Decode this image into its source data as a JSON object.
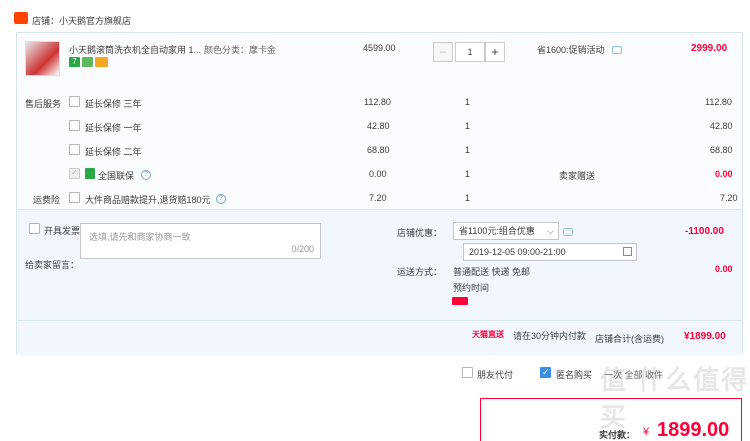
{
  "shop": {
    "label": "店铺：小天鹅官方旗舰店"
  },
  "item": {
    "title": "小天鹅滚筒洗衣机全自动家用 1...",
    "variant": "颜色分类：摩卡金",
    "unit_price": "4599.00",
    "quantity": "1",
    "minus": "−",
    "plus": "+",
    "promo": "省1600:促销活动",
    "subtotal": "2999.00",
    "tag7": "7"
  },
  "services": {
    "label": "售后服务",
    "rows": [
      {
        "name": "延长保修 三年",
        "price": "112.80",
        "qty": "1",
        "total": "112.80"
      },
      {
        "name": "延长保修 一年",
        "price": "42.80",
        "qty": "1",
        "total": "42.80"
      },
      {
        "name": "延长保修 二年",
        "price": "68.80",
        "qty": "1",
        "total": "68.80"
      },
      {
        "name": "全国联保",
        "price": "0.00",
        "qty": "1",
        "note": "卖家赠送",
        "total": "0.00"
      }
    ]
  },
  "insurance": {
    "label": "运费险",
    "name": "大件商品赔款提升,退货赔180元",
    "price": "7.20",
    "qty": "1",
    "total": "7.20"
  },
  "invoice": {
    "label": "开具发票"
  },
  "shop_discount": {
    "label": "店铺优惠：",
    "selected": "省1100元:组合优惠",
    "amount": "-1100.00"
  },
  "message": {
    "label": "给卖家留言：",
    "placeholder": "选填,请先和商家协商一致",
    "counter": "0/200"
  },
  "shipping": {
    "label": "运送方式：",
    "method": "普通配送 快递 免邮",
    "appointment_label": "预约时间",
    "appointment": "2019-12-05 09:00-21:00",
    "amount": "0.00",
    "tmall_label": "天猫直送",
    "tmall_note": "请在30分钟内付款"
  },
  "shop_total": {
    "label": "店铺合计(含运费)",
    "amount": "¥1899.00"
  },
  "footer": {
    "friend_pay": "朋友代付",
    "anonymous": "匿名购买",
    "extra": "一次   全部   收件"
  },
  "final": {
    "label": "实付款：",
    "currency": "¥",
    "amount": "1899.00"
  },
  "watermark": "值 什么值得买"
}
